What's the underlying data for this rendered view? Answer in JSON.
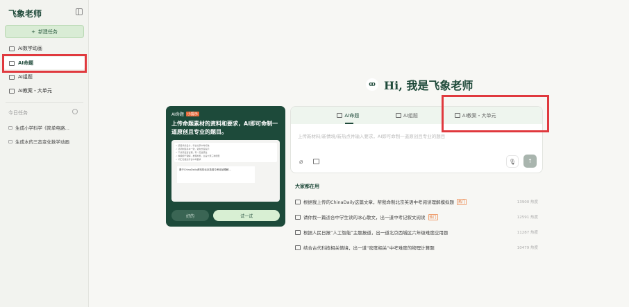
{
  "sidebar": {
    "logo": "飞象老师",
    "new_task": "新建任务",
    "items": [
      {
        "label": "AI数学动画"
      },
      {
        "label": "AI命题"
      },
      {
        "label": "AI组题"
      },
      {
        "label": "AI教案・大单元"
      }
    ],
    "today_label": "今日任务",
    "tasks": [
      {
        "label": "生成小学科学《简单电路…"
      },
      {
        "label": "生成水的三态变化数学动画"
      }
    ]
  },
  "main": {
    "greeting": "Hi, 我是飞象老师",
    "avatar": "ꝏ",
    "tabs": [
      {
        "label": "AI命题"
      },
      {
        "label": "AI组题"
      },
      {
        "label": "AI教案・大单元"
      }
    ],
    "placeholder": "上传新材料/新情境/新热点并输入要求，AI即可命制一道原创且专业的题目",
    "popular_title": "大家都在用",
    "popular": [
      {
        "text": "根据我上传的ChinaDaily这篇文章，帮我命制北京英语中考阅读理解模拟题",
        "hot": "热门",
        "count": "13900 热度"
      },
      {
        "text": "请你找一篇适合中学生读的冰心散文，出一道中考记叙文阅读",
        "hot": "热门",
        "count": "12591 热度"
      },
      {
        "text": "根据人民日报“人工智能”主题报道，出一道北京西城区六年级难度应用题",
        "count": "11287 热度"
      },
      {
        "text": "结合古代科技相关情境，出一道“密度相关”中考难度的物理计算题",
        "count": "10479 热度"
      }
    ]
  },
  "tooltip": {
    "tag": "AI命题",
    "badge": "小提示",
    "title": "上传命题素材的资料和要求，AI即可命制一道原创且专业的题目。",
    "preview_lines": [
      "✓ 题目情境设计，符合北京中考标准",
      "✓ 选项制造基本一致，避免长度提示",
      "✓ 干扰项设置合理，有一定迷惑性",
      "✓ 精确题干理解，推理判断，主旨大意三种题型",
      "✓ 词汇和语法符合中考要求"
    ],
    "preview_doc": "基于ChinaDaily资料的北京英语中考阅读理解...",
    "ok": "好的",
    "try": "试一试"
  }
}
